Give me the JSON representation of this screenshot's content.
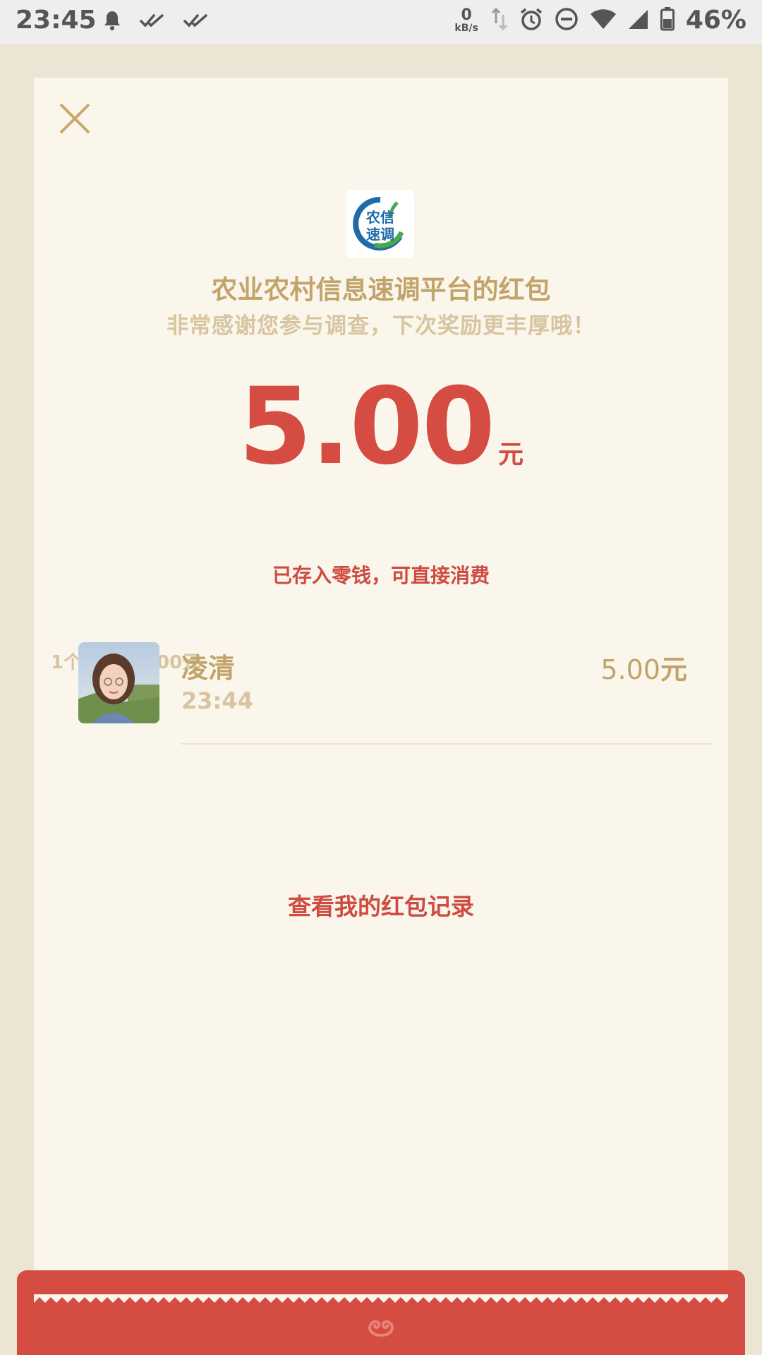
{
  "status_bar": {
    "time": "23:45",
    "net_speed_value": "0",
    "net_speed_unit": "kB/s",
    "battery_percent": "46%",
    "icons": [
      "bell-icon",
      "double-check-icon",
      "double-check-icon",
      "data-arrows-icon",
      "alarm-icon",
      "dnd-icon",
      "wifi-icon",
      "signal-icon",
      "battery-icon"
    ]
  },
  "card": {
    "title": "农业农村信息速调平台的红包",
    "subtitle": "非常感谢您参与调查，下次奖励更丰厚哦！",
    "amount": "5.00",
    "amount_unit": "元",
    "stored_note": "已存入零钱，可直接消费",
    "summary": "1个红包共5.00元",
    "records_link": "查看我的红包记录"
  },
  "receipt": {
    "name": "凌清",
    "time": "23:44",
    "amount": "5.00",
    "unit": "元"
  },
  "colors": {
    "accent_red": "#d44c42",
    "gold_text": "#c2a46a",
    "muted_text": "#d8c4a0",
    "card_bg": "#faf6ec",
    "page_bg": "#ede5d4"
  }
}
